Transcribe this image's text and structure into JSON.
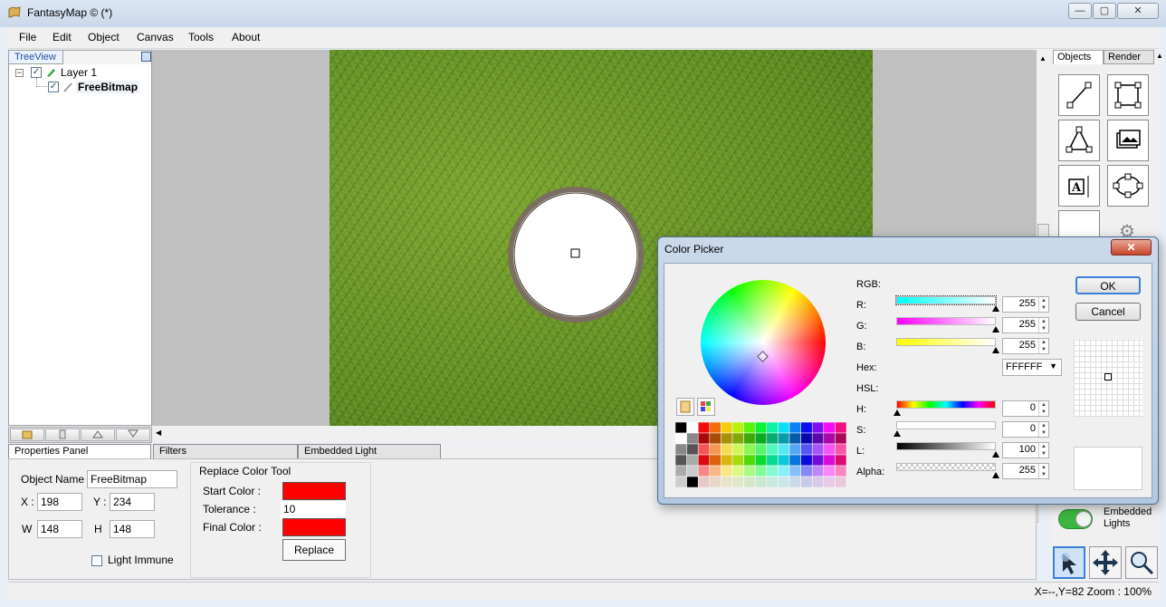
{
  "window": {
    "title": "FantasyMap © (*)",
    "min": "—",
    "max": "▢",
    "close": "✕"
  },
  "menu": [
    "File",
    "Edit",
    "Object",
    "Canvas",
    "Tools",
    "About"
  ],
  "treeview": {
    "tab_label": "TreeView",
    "items": [
      {
        "label": "Layer 1",
        "checked": "✓"
      },
      {
        "label": "FreeBitmap",
        "checked": "✓"
      }
    ]
  },
  "right_panel": {
    "tabs": [
      "Objects",
      "Render"
    ],
    "toggle_label": "Embedded Lights"
  },
  "bottom_tabs": [
    "Properties Panel",
    "Filters",
    "Embedded Light"
  ],
  "properties": {
    "object_name_label": "Object Name",
    "object_name": "FreeBitmap",
    "x_label": "X :",
    "x": "198",
    "y_label": "Y :",
    "y": "234",
    "w_label": "W",
    "w": "148",
    "h_label": "H",
    "h": "148",
    "light_immune_label": "Light Immune"
  },
  "replace_tool": {
    "title": "Replace Color Tool",
    "start_label": "Start Color :",
    "start_color": "#ff0000",
    "tolerance_label": "Tolerance :",
    "tolerance": "10",
    "final_label": "Final Color :",
    "final_color": "#ff0000",
    "button": "Replace"
  },
  "status": "X=--,Y=82  Zoom : 100%",
  "color_picker": {
    "title": "Color Picker",
    "close": "✕",
    "rgb_label": "RGB:",
    "r_label": "R:",
    "r": "255",
    "g_label": "G:",
    "g": "255",
    "b_label": "B:",
    "b": "255",
    "hex_label": "Hex:",
    "hex": "FFFFFF",
    "hsl_label": "HSL:",
    "h_label": "H:",
    "h": "0",
    "s_label": "S:",
    "s": "0",
    "l_label": "L:",
    "l": "100",
    "alpha_label": "Alpha:",
    "alpha": "255",
    "ok": "OK",
    "cancel": "Cancel",
    "selected_color": "#ffffff"
  }
}
